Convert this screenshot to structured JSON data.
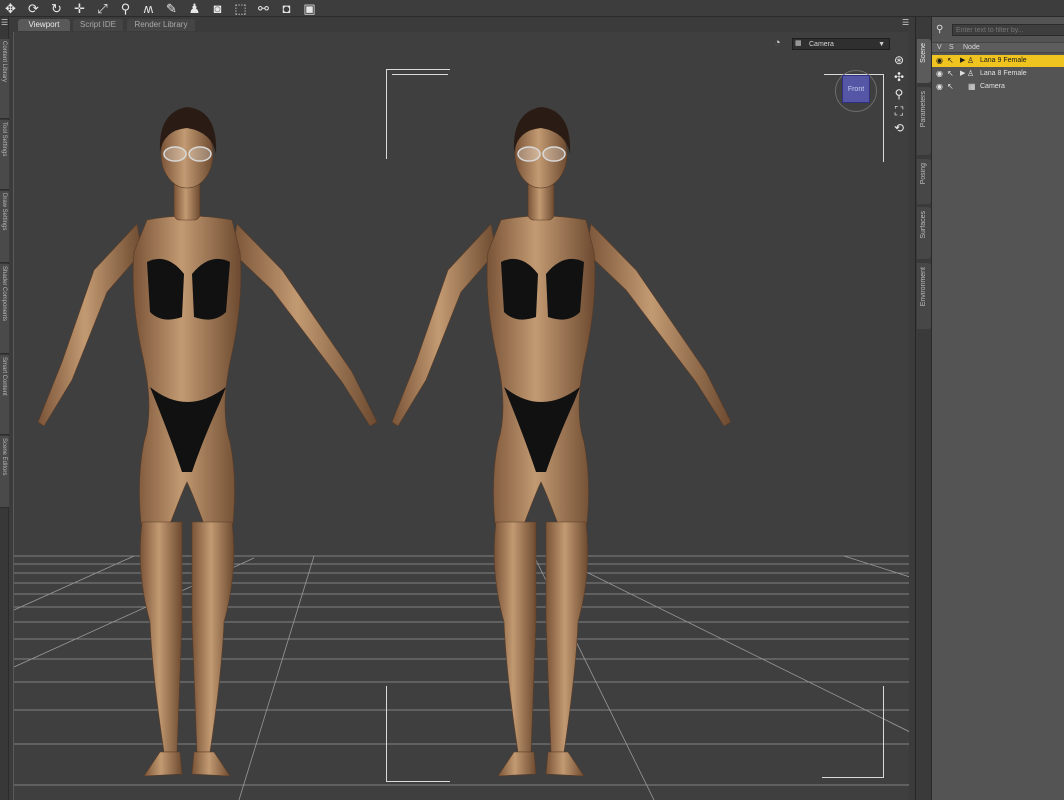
{
  "toolbar": {
    "tools": [
      "universal-tool-icon",
      "rotate-tool-icon",
      "twist-tool-icon",
      "translate-tool-icon",
      "scale-tool-icon",
      "joint-editor-icon",
      "morph-tool-icon",
      "brush-tool-icon",
      "figure-tool-icon",
      "camera-tool-icon",
      "region-select-icon",
      "node-select-icon",
      "spot-render-icon",
      "render-icon"
    ]
  },
  "left_dock": {
    "tabs": [
      "Content Library",
      "Tool Settings",
      "Draw Settings",
      "Shader Components",
      "Smart Content",
      "Scene Editors"
    ]
  },
  "tabs": {
    "items": [
      "Viewport",
      "Script IDE",
      "Render Library"
    ],
    "active": "Viewport"
  },
  "viewport": {
    "camera_label": "Camera",
    "cube_face": "Front",
    "nav_tools": [
      "orbit-icon",
      "pan-icon",
      "zoom-icon",
      "frame-icon",
      "reset-view-icon"
    ],
    "colors": {
      "background": "#3f3f3f",
      "grid": "#9a9a9a",
      "cube": "#5557a6",
      "skin": "#b58a63",
      "swimsuit": "#111111"
    }
  },
  "right_panel": {
    "tabs": [
      "Scene",
      "Parameters",
      "Posing",
      "Surfaces",
      "Environment"
    ],
    "active_tab": "Scene",
    "filter_placeholder": "Enter text to filter by...",
    "columns": [
      "V",
      "S",
      "Node"
    ],
    "nodes": [
      {
        "label": "Lana 9 Female",
        "selected": true,
        "icon": "figure-icon"
      },
      {
        "label": "Lana 8 Female",
        "selected": false,
        "icon": "figure-icon"
      },
      {
        "label": "Camera",
        "selected": false,
        "icon": "camera-icon"
      }
    ],
    "selection_color": "#f0c420"
  }
}
